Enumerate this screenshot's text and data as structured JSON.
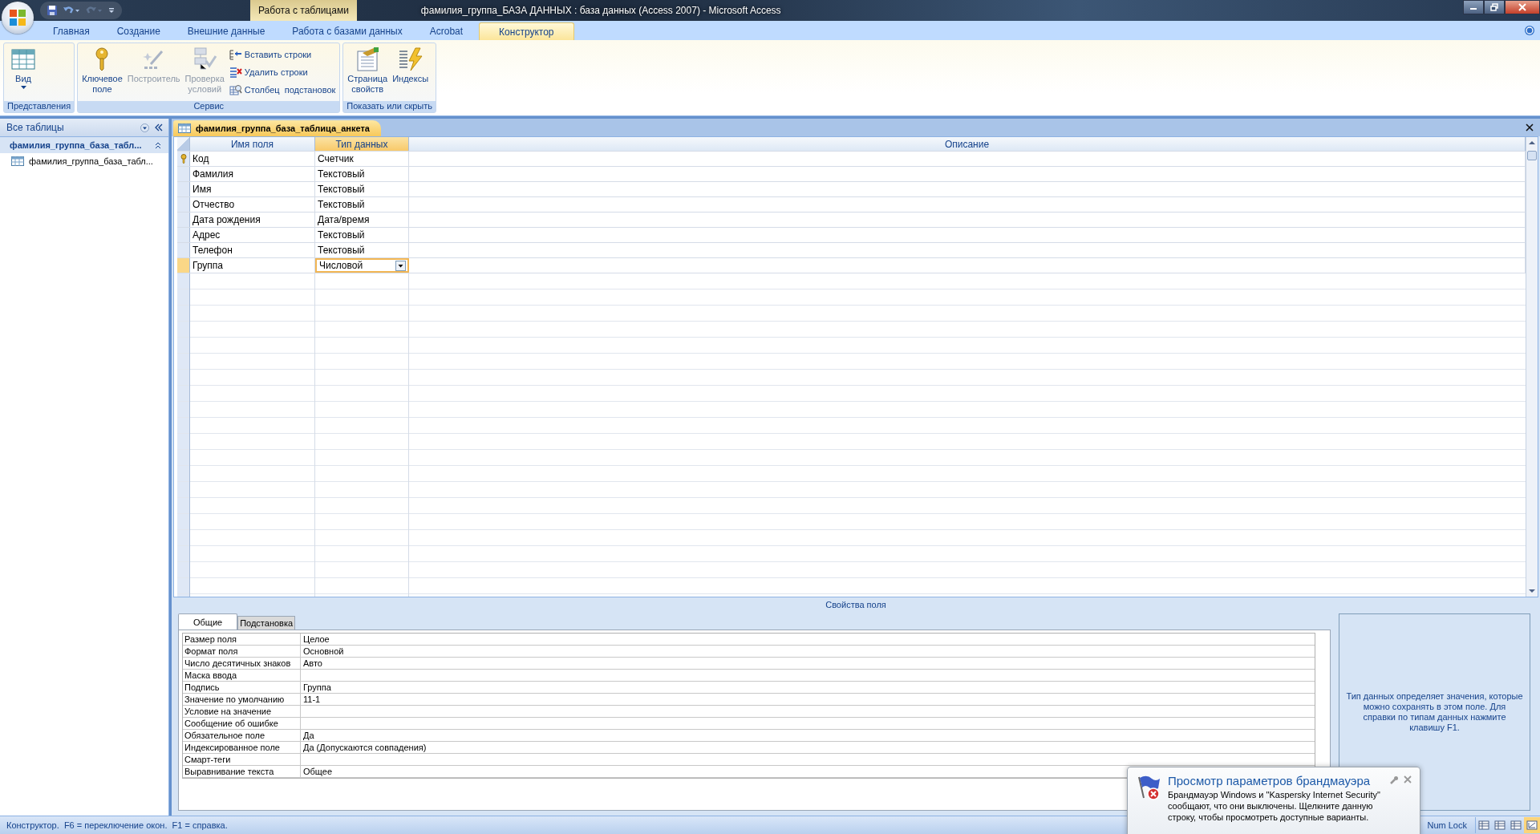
{
  "window": {
    "title": "фамилия_группа_БАЗА ДАННЫХ : база данных (Access 2007)  -  Microsoft Access",
    "context_tab": "Работа с таблицами"
  },
  "ribbon_tabs": [
    {
      "label": "Главная",
      "selected": false
    },
    {
      "label": "Создание",
      "selected": false
    },
    {
      "label": "Внешние данные",
      "selected": false
    },
    {
      "label": "Работа с базами данных",
      "selected": false
    },
    {
      "label": "Acrobat",
      "selected": false
    },
    {
      "label": "Конструктор",
      "selected": true
    }
  ],
  "ribbon_groups": [
    {
      "label": "Представления",
      "items": [
        {
          "kind": "large",
          "label": "Вид",
          "disabled": false,
          "dropdown": true
        }
      ]
    },
    {
      "label": "Сервис",
      "items": [
        {
          "kind": "large",
          "label": "Ключевое\nполе",
          "disabled": false
        },
        {
          "kind": "large",
          "label": "Построитель",
          "disabled": true
        },
        {
          "kind": "large",
          "label": "Проверка\nусловий",
          "disabled": true
        },
        {
          "kind": "small",
          "label": "Вставить строки",
          "disabled": false
        },
        {
          "kind": "small",
          "label": "Удалить строки",
          "disabled": false
        },
        {
          "kind": "small",
          "label": "Столбец  подстановок",
          "disabled": false
        }
      ]
    },
    {
      "label": "Показать или скрыть",
      "items": [
        {
          "kind": "large",
          "label": "Страница\nсвойств",
          "disabled": false
        },
        {
          "kind": "large",
          "label": "Индексы",
          "disabled": false
        }
      ]
    }
  ],
  "nav": {
    "header": "Все таблицы",
    "groups": [
      {
        "label": "фамилия_группа_база_табл...",
        "expanded": true,
        "items": [
          {
            "label": "фамилия_группа_база_табл...",
            "selected": false
          }
        ]
      }
    ]
  },
  "document": {
    "tab": "фамилия_группа_база_таблица_анкета",
    "columns": [
      {
        "label": "Имя поля",
        "selected": false
      },
      {
        "label": "Тип данных",
        "selected": true
      },
      {
        "label": "Описание",
        "selected": false
      }
    ],
    "rows": [
      {
        "field": "Код",
        "type": "Счетчик",
        "primary_key": true,
        "selected": false
      },
      {
        "field": "Фамилия",
        "type": "Текстовый",
        "primary_key": false,
        "selected": false
      },
      {
        "field": "Имя",
        "type": "Текстовый",
        "primary_key": false,
        "selected": false
      },
      {
        "field": "Отчество",
        "type": "Текстовый",
        "primary_key": false,
        "selected": false
      },
      {
        "field": "Дата рождения",
        "type": "Дата/время",
        "primary_key": false,
        "selected": false
      },
      {
        "field": "Адрес",
        "type": "Текстовый",
        "primary_key": false,
        "selected": false
      },
      {
        "field": "Телефон",
        "type": "Текстовый",
        "primary_key": false,
        "selected": false
      },
      {
        "field": "Группа",
        "type": "Числовой",
        "primary_key": false,
        "selected": true
      }
    ]
  },
  "properties": {
    "caption": "Свойства поля",
    "tabs": [
      {
        "label": "Общие",
        "selected": true
      },
      {
        "label": "Подстановка",
        "selected": false
      }
    ],
    "rows": [
      {
        "label": "Размер поля",
        "value": "Целое"
      },
      {
        "label": "Формат поля",
        "value": "Основной"
      },
      {
        "label": "Число десятичных знаков",
        "value": "Авто"
      },
      {
        "label": "Маска ввода"
      },
      {
        "label": "Подпись",
        "value": "Группа"
      },
      {
        "label": "Значение по умолчанию",
        "value": "11-1"
      },
      {
        "label": "Условие на значение"
      },
      {
        "label": "Сообщение об ошибке"
      },
      {
        "label": "Обязательное поле",
        "value": "Да"
      },
      {
        "label": "Индексированное поле",
        "value": "Да (Допускаются совпадения)"
      },
      {
        "label": "Смарт-теги"
      },
      {
        "label": "Выравнивание текста",
        "value": "Общее"
      }
    ],
    "help": "Тип данных определяет значения, которые можно сохранять в этом поле.  Для справки по типам данных нажмите клавишу F1."
  },
  "status_bar": {
    "text": "Конструктор.  F6 = переключение окон.  F1 = справка.",
    "indicator": "Num Lock",
    "view_buttons": [
      {
        "selected": false
      },
      {
        "selected": false
      },
      {
        "selected": false
      },
      {
        "selected": true
      }
    ]
  },
  "notification": {
    "title": "Просмотр параметров брандмауэра",
    "text": "Брандмауэр Windows и \"Kaspersky Internet Security\" сообщают, что они выключены. Щелкните данную строку, чтобы просмотреть доступные варианты."
  }
}
